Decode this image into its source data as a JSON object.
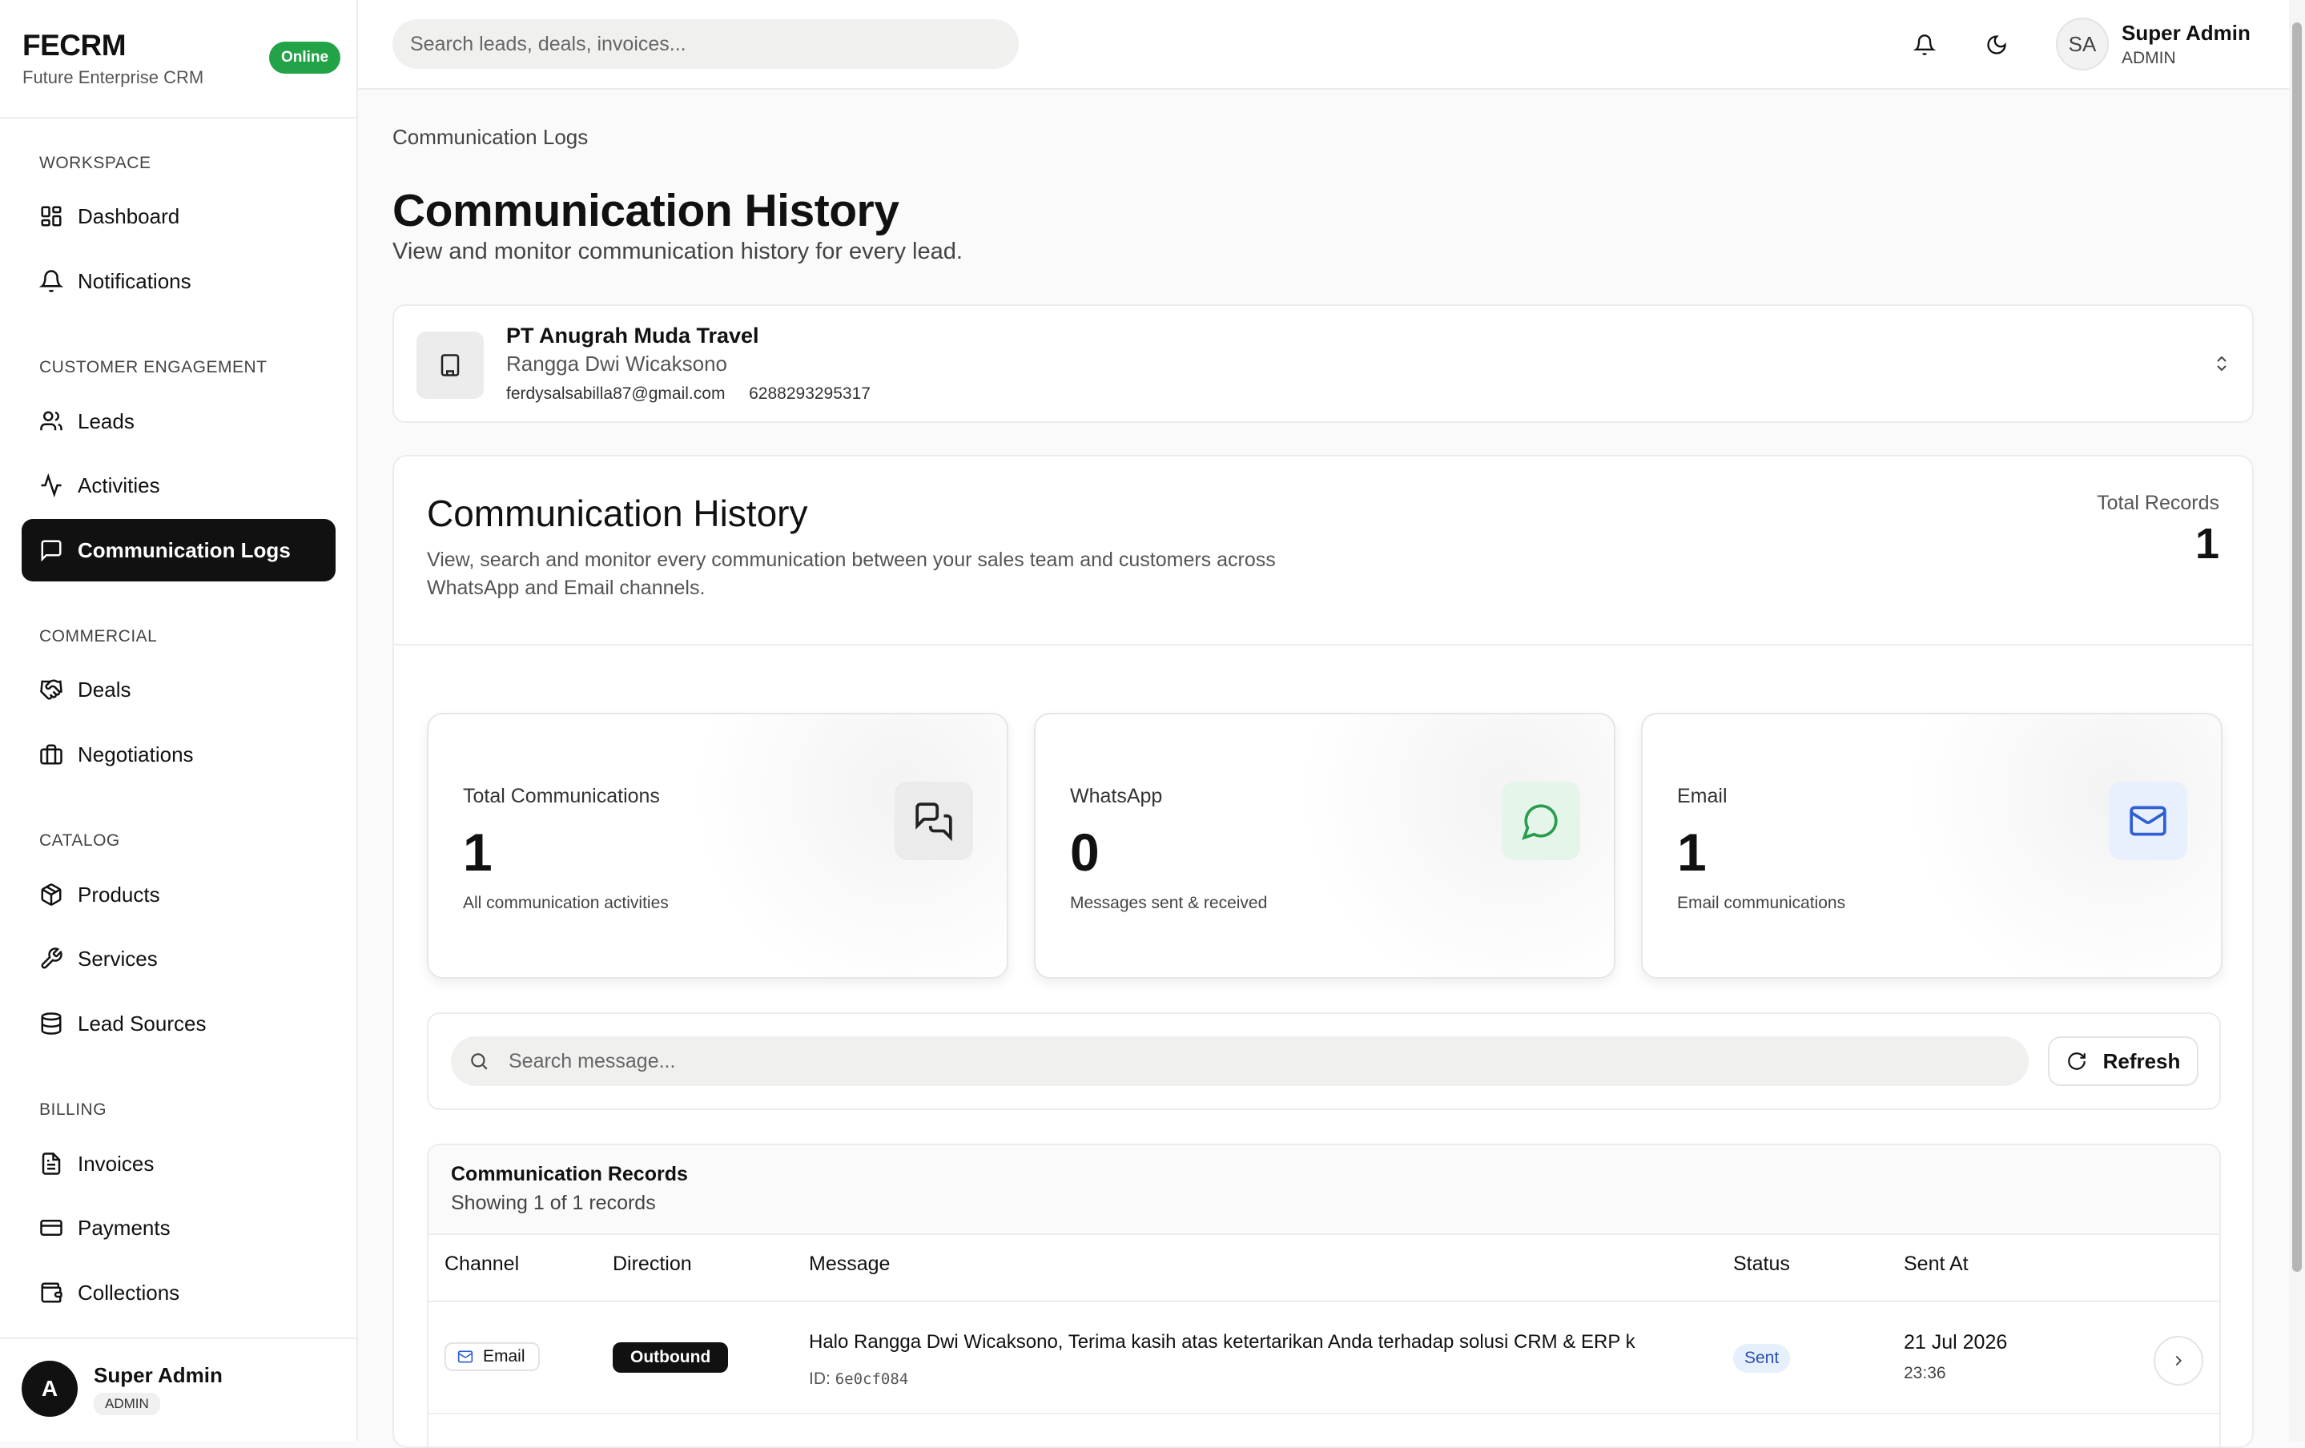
{
  "brand": {
    "name": "FECRM",
    "subtitle": "Future Enterprise CRM",
    "status": "Online"
  },
  "sidebar": {
    "sections": [
      "WORKSPACE",
      "CUSTOMER ENGAGEMENT",
      "COMMERCIAL",
      "CATALOG",
      "BILLING"
    ],
    "items": [
      {
        "label": "Dashboard",
        "icon": "dashboard-icon"
      },
      {
        "label": "Notifications",
        "icon": "bell-icon"
      },
      {
        "label": "Leads",
        "icon": "users-icon"
      },
      {
        "label": "Activities",
        "icon": "activity-icon"
      },
      {
        "label": "Communication Logs",
        "icon": "message-square-icon",
        "active": true
      },
      {
        "label": "Deals",
        "icon": "handshake-icon"
      },
      {
        "label": "Negotiations",
        "icon": "briefcase-icon"
      },
      {
        "label": "Products",
        "icon": "package-icon"
      },
      {
        "label": "Services",
        "icon": "wrench-icon"
      },
      {
        "label": "Lead Sources",
        "icon": "database-icon"
      },
      {
        "label": "Invoices",
        "icon": "file-text-icon"
      },
      {
        "label": "Payments",
        "icon": "credit-card-icon"
      },
      {
        "label": "Collections",
        "icon": "wallet-icon"
      }
    ],
    "user": {
      "initial": "A",
      "name": "Super Admin",
      "role": "ADMIN"
    }
  },
  "topbar": {
    "search_placeholder": "Search leads, deals, invoices...",
    "user": {
      "initials": "SA",
      "name": "Super Admin",
      "role": "ADMIN"
    }
  },
  "page": {
    "breadcrumb": "Communication Logs",
    "title": "Communication History",
    "subtitle": "View and monitor communication history for every lead."
  },
  "lead": {
    "company": "PT Anugrah Muda Travel",
    "person": "Rangga Dwi Wicaksono",
    "email": "ferdysalsabilla87@gmail.com",
    "phone": "6288293295317"
  },
  "history": {
    "title": "Communication History",
    "description": "View, search and monitor every communication between your sales team and customers across WhatsApp and Email channels.",
    "total_label": "Total Records",
    "total_value": "1"
  },
  "stats": [
    {
      "label": "Total Communications",
      "value": "1",
      "sub": "All communication activities",
      "icon": "messages-icon",
      "tint": "#ebebeb",
      "stroke": "#222222"
    },
    {
      "label": "WhatsApp",
      "value": "0",
      "sub": "Messages sent & received",
      "icon": "whatsapp-icon",
      "tint": "#e5f5ea",
      "stroke": "#2a9d4e"
    },
    {
      "label": "Email",
      "value": "1",
      "sub": "Email communications",
      "icon": "mail-icon",
      "tint": "#e8effd",
      "stroke": "#2f5fd0"
    }
  ],
  "filters": {
    "search_placeholder": "Search message...",
    "refresh_label": "Refresh"
  },
  "records": {
    "title": "Communication Records",
    "count_text": "Showing 1 of 1 records",
    "columns": [
      "Channel",
      "Direction",
      "Message",
      "Status",
      "Sent At"
    ],
    "rows": [
      {
        "channel": "Email",
        "direction": "Outbound",
        "message": "Halo Rangga Dwi Wicaksono, Terima kasih atas ketertarikan Anda terhadap solusi CRM & ERP k",
        "id_label": "ID:",
        "id": "6e0cf084",
        "status": "Sent",
        "date": "21 Jul 2026",
        "time": "23:36"
      }
    ]
  }
}
